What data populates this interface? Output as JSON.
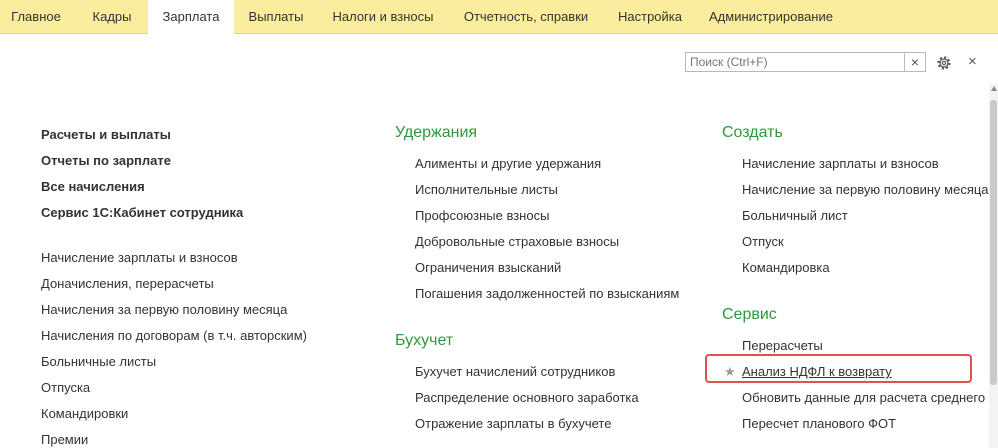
{
  "tabs": [
    "Главное",
    "Кадры",
    "Зарплата",
    "Выплаты",
    "Налоги и взносы",
    "Отчетность, справки",
    "Настройка",
    "Администрирование"
  ],
  "search": {
    "placeholder": "Поиск (Ctrl+F)",
    "clear": "×"
  },
  "close_label": "×",
  "col1": {
    "bold_items": [
      "Расчеты и выплаты",
      "Отчеты по зарплате",
      "Все начисления",
      "Сервис 1С:Кабинет сотрудника"
    ],
    "items": [
      "Начисление зарплаты и взносов",
      "Доначисления, перерасчеты",
      "Начисления за первую половину месяца",
      "Начисления по договорам (в т.ч. авторским)",
      "Больничные листы",
      "Отпуска",
      "Командировки",
      "Премии"
    ]
  },
  "col2": {
    "sections": [
      {
        "title": "Удержания",
        "items": [
          "Алименты и другие удержания",
          "Исполнительные листы",
          "Профсоюзные взносы",
          "Добровольные страховые взносы",
          "Ограничения взысканий",
          "Погашения задолженностей по взысканиям"
        ]
      },
      {
        "title": "Бухучет",
        "items": [
          "Бухучет начислений сотрудников",
          "Распределение основного заработка",
          "Отражение зарплаты в бухучете"
        ]
      }
    ]
  },
  "col3": {
    "sections": [
      {
        "title": "Создать",
        "items": [
          "Начисление зарплаты и взносов",
          "Начисление за первую половину месяца",
          "Больничный лист",
          "Отпуск",
          "Командировка"
        ]
      },
      {
        "title": "Сервис",
        "items": [
          "Перерасчеты",
          "Анализ НДФЛ к возврату",
          "Обновить данные для расчета среднего",
          "Пересчет планового ФОТ"
        ]
      }
    ]
  },
  "active_tab_index": 2,
  "colors": {
    "topbar": "#fbed9e",
    "section_title": "#2c9a3a",
    "highlight": "#d9534f"
  }
}
